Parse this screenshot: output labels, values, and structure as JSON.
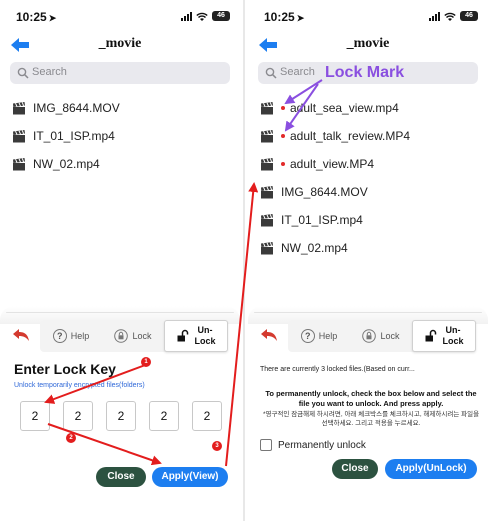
{
  "left": {
    "status": {
      "time": "10:25",
      "battery": "46"
    },
    "title": "_movie",
    "search_placeholder": "Search",
    "files": [
      "IMG_8644.MOV",
      "IT_01_ISP.mp4",
      "NW_02.mp4"
    ],
    "toolbar": {
      "help": "Help",
      "lock": "Lock",
      "unlock_line1": "Un-",
      "unlock_line2": "Lock"
    },
    "lock_key_title": "Enter Lock Key",
    "lock_key_subtitle": "Unlock temporarily encrypted files(folders)",
    "key_values": [
      "2",
      "2",
      "2",
      "2",
      "2"
    ],
    "close_label": "Close",
    "apply_label": "Apply(View)"
  },
  "right": {
    "status": {
      "time": "10:25",
      "battery": "46"
    },
    "title": "_movie",
    "search_placeholder": "Search",
    "locked_files": [
      "adult_sea_view.mp4",
      "adult_talk_review.MP4",
      "adult_view.MP4"
    ],
    "files": [
      "IMG_8644.MOV",
      "IT_01_ISP.mp4",
      "NW_02.mp4"
    ],
    "toolbar": {
      "help": "Help",
      "lock": "Lock",
      "unlock_line1": "Un-",
      "unlock_line2": "Lock"
    },
    "info_count": "There are currently 3 locked files.(Based on curr...",
    "info_instruction": "To permanently unlock, check the box below and select the file you want to unlock. And press apply.",
    "info_korean": "*영구적인 잠금해제 하시려면, 아래 체크박스를 체크하시고, 해제하시려는 파일을 선택하세요. 그리고 적용을 누르세요.",
    "permanently_unlock_label": "Permanently unlock",
    "permanently_unlock_checked": false,
    "close_label": "Close",
    "apply_label": "Apply(UnLock)"
  },
  "annotations": {
    "lock_mark_label": "Lock Mark",
    "steps": [
      "1",
      "2",
      "3"
    ]
  },
  "colors": {
    "accent_blue": "#1d7ef0",
    "close_green": "#2c5240",
    "lock_dot_red": "#e22a2a",
    "annotation_red": "#e31d1d",
    "annotation_purple": "#8a4fe0"
  }
}
